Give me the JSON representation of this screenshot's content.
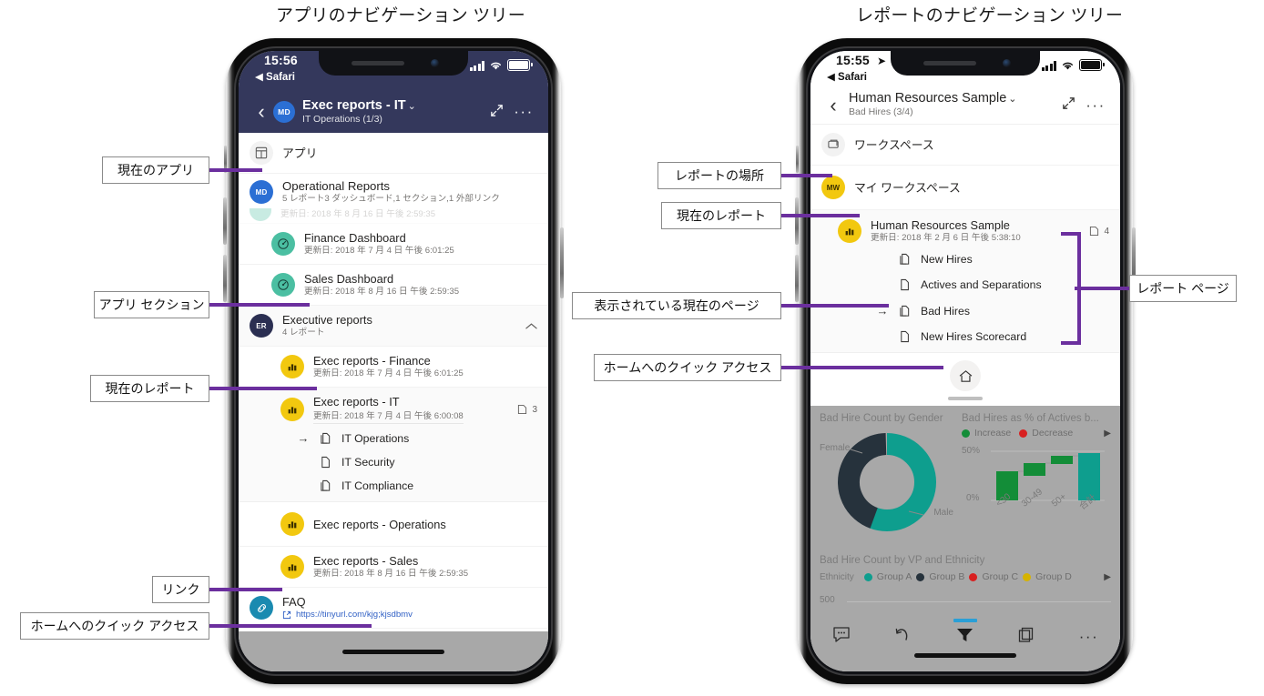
{
  "figure": {
    "left_caption": "アプリのナビゲーション ツリー",
    "right_caption": "レポートのナビゲーション ツリー",
    "accent_color": "#6b2f9e"
  },
  "left_phone": {
    "status_bar": {
      "time": "15:56",
      "back_app": "◀ Safari"
    },
    "header": {
      "back_icon": "chevron-left-icon",
      "avatar_initials": "MD",
      "title": "Exec reports - IT",
      "chevron": "⌄",
      "subtitle": "IT Operations (1/3)",
      "expand_icon": "expand-icon",
      "more_icon": "more-icon",
      "background": "#34385c"
    },
    "apps_row": {
      "label": "アプリ",
      "icon": "apps-grid-icon"
    },
    "items": [
      {
        "kind": "app",
        "initials": "MD",
        "avatar_color": "#2b6fd4",
        "title": "Operational Reports",
        "subtitle": "5 レポート3 ダッシュボード,1 セクション,1 外部リンク"
      },
      {
        "kind": "partial",
        "title": "",
        "subtitle": "更新日: 2018 年 8 月 16 日 午後 2:59:35"
      },
      {
        "kind": "dashboard",
        "icon": "dashboard-icon",
        "icon_color": "#4bbfa2",
        "title": "Finance Dashboard",
        "subtitle": "更新日: 2018 年 7 月 4 日 午後 6:01:25"
      },
      {
        "kind": "dashboard",
        "icon": "dashboard-icon",
        "icon_color": "#4bbfa2",
        "title": "Sales Dashboard",
        "subtitle": "更新日: 2018 年 8 月 16 日 午後 2:59:35"
      },
      {
        "kind": "section",
        "initials": "ER",
        "avatar_color": "#2b2f52",
        "title": "Executive reports",
        "subtitle": "4 レポート",
        "collapse_icon": "chevron-up-icon"
      },
      {
        "kind": "report",
        "icon": "report-icon",
        "icon_color": "#f2c80f",
        "title": "Exec reports - Finance",
        "subtitle": "更新日: 2018 年 7 月 4 日 午後 6:01:25"
      },
      {
        "kind": "report-current",
        "icon": "report-icon",
        "icon_color": "#f2c80f",
        "title": "Exec reports - IT",
        "subtitle": "更新日: 2018 年 7 月 4 日 午後 6:00:08",
        "page_count": "3",
        "pages": [
          {
            "label": "IT Operations",
            "current": true,
            "icon": "page-multi-icon"
          },
          {
            "label": "IT Security",
            "current": false,
            "icon": "page-icon"
          },
          {
            "label": "IT Compliance",
            "current": false,
            "icon": "page-multi-icon"
          }
        ]
      },
      {
        "kind": "report",
        "icon": "report-icon",
        "icon_color": "#f2c80f",
        "title": "Exec reports - Operations",
        "subtitle": ""
      },
      {
        "kind": "report",
        "icon": "report-icon",
        "icon_color": "#f2c80f",
        "title": "Exec reports - Sales",
        "subtitle": "更新日: 2018 年 8 月 16 日 午後 2:59:35"
      },
      {
        "kind": "link",
        "icon": "link-icon",
        "icon_color": "#1a8ab0",
        "title": "FAQ",
        "url": "https://tinyurl.com/kjg;kjsdbmv",
        "url_icon": "external-link-icon"
      }
    ],
    "home_button": {
      "icon": "home-icon"
    }
  },
  "right_phone": {
    "status_bar": {
      "time": "15:55",
      "location_icon": "➤",
      "back_app": "◀ Safari"
    },
    "header": {
      "back_icon": "chevron-left-icon",
      "title": "Human Resources Sample",
      "chevron": "⌄",
      "subtitle": "Bad Hires (3/4)",
      "expand_icon": "expand-icon",
      "more_icon": "more-icon",
      "background": "#ffffff"
    },
    "workspace_row": {
      "label": "ワークスペース",
      "icon": "workspace-icon"
    },
    "my_workspace": {
      "initials": "MW",
      "avatar_color": "#f2c80f",
      "label": "マイ ワークスペース"
    },
    "current_report": {
      "icon": "report-icon",
      "icon_color": "#f2c80f",
      "title": "Human Resources Sample",
      "subtitle": "更新日: 2018 年 2 月 6 日 午後 5:38:10",
      "page_count": "4",
      "pages": [
        {
          "label": "New Hires",
          "current": false,
          "icon": "page-multi-icon"
        },
        {
          "label": "Actives and Separations",
          "current": false,
          "icon": "page-icon"
        },
        {
          "label": "Bad Hires",
          "current": true,
          "icon": "page-multi-icon"
        },
        {
          "label": "New Hires Scorecard",
          "current": false,
          "icon": "page-icon"
        }
      ]
    },
    "home_button": {
      "icon": "home-icon"
    },
    "report_canvas": {
      "visuals": [
        {
          "title": "Bad Hire Count by Gender"
        },
        {
          "title": "Bad Hires as % of Actives b..."
        },
        {
          "title": "Bad Hire Count by VP and Ethnicity"
        }
      ],
      "donut": {
        "labels": [
          "Female",
          "Male"
        ],
        "colors": [
          "#26323c",
          "#0e9e8e"
        ]
      },
      "waterfall": {
        "legend": [
          {
            "label": "Increase",
            "color": "#138d38"
          },
          {
            "label": "Decrease",
            "color": "#d82020"
          }
        ],
        "axis_ticks": [
          "50%",
          "0%"
        ],
        "categories": [
          "<30",
          "30-49",
          "50+",
          "合計"
        ],
        "expand_icon": "caret-right-icon"
      },
      "ethnicity": {
        "label": "Ethnicity",
        "legend": [
          {
            "label": "Group A",
            "color": "#0e9e8e"
          },
          {
            "label": "Group B",
            "color": "#26323c"
          },
          {
            "label": "Group C",
            "color": "#d82020"
          },
          {
            "label": "Group D",
            "color": "#d6b300"
          }
        ],
        "axis_tick": "500",
        "expand_icon": "caret-right-icon"
      }
    },
    "action_bar": {
      "items": [
        {
          "icon": "comment-icon"
        },
        {
          "icon": "undo-icon"
        },
        {
          "icon": "filter-icon"
        },
        {
          "icon": "pages-icon"
        },
        {
          "icon": "more-icon"
        }
      ]
    }
  },
  "chart_data": [
    {
      "type": "pie",
      "title": "Bad Hire Count by Gender",
      "categories": [
        "Male",
        "Female"
      ],
      "values": [
        55,
        45
      ],
      "colors": [
        "#0e9e8e",
        "#26323c"
      ]
    },
    {
      "type": "bar",
      "title": "Bad Hires as % of Actives b...",
      "categories": [
        "<30",
        "30-49",
        "50+",
        "合計"
      ],
      "values": [
        30,
        41,
        46,
        47
      ],
      "ylabel": "",
      "ylim": [
        0,
        55
      ],
      "ytick_labels": [
        "0%",
        "50%"
      ],
      "legend": [
        "Increase",
        "Decrease"
      ],
      "legend_position": "top"
    },
    {
      "type": "bar",
      "title": "Bad Hire Count by VP and Ethnicity",
      "categories": [],
      "series": [
        {
          "name": "Group A",
          "values": []
        },
        {
          "name": "Group B",
          "values": []
        },
        {
          "name": "Group C",
          "values": []
        },
        {
          "name": "Group D",
          "values": []
        }
      ],
      "ytick_labels": [
        "500"
      ],
      "legend_position": "top"
    }
  ],
  "annotations": {
    "left": [
      {
        "id": "current-app",
        "label": "現在のアプリ"
      },
      {
        "id": "app-section",
        "label": "アプリ セクション"
      },
      {
        "id": "current-report",
        "label": "現在のレポート"
      },
      {
        "id": "link",
        "label": "リンク"
      },
      {
        "id": "home-quick-access",
        "label": "ホームへのクイック アクセス"
      }
    ],
    "right": [
      {
        "id": "report-location",
        "label": "レポートの場所"
      },
      {
        "id": "current-report",
        "label": "現在のレポート"
      },
      {
        "id": "current-page",
        "label": "表示されている現在のページ"
      },
      {
        "id": "home-quick-access",
        "label": "ホームへのクイック アクセス"
      },
      {
        "id": "report-pages",
        "label": "レポート ページ"
      }
    ]
  }
}
